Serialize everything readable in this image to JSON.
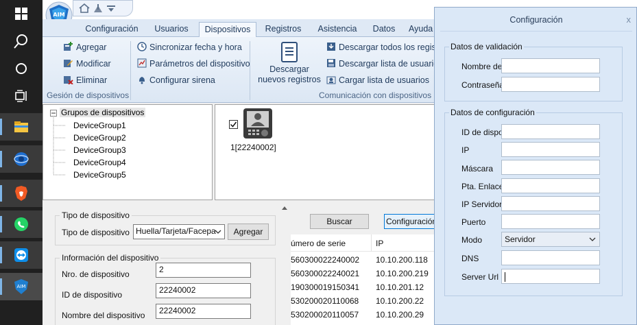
{
  "app": {
    "tabs": [
      "Configuración",
      "Usuarios",
      "Dispositivos",
      "Registros",
      "Asistencia",
      "Datos",
      "Ayuda"
    ],
    "active_tab": "Dispositivos"
  },
  "ribbon": {
    "group1": {
      "items": [
        "Agregar",
        "Modificar",
        "Eliminar"
      ],
      "label": "Gesión de dispositivos"
    },
    "group2": {
      "items": [
        "Sincronizar fecha y hora",
        "Parámetros del dispositivo",
        "Configurar sirena"
      ]
    },
    "group3": {
      "big_button_line1": "Descargar",
      "big_button_line2": "nuevos registros",
      "items": [
        "Descargar todos los registr",
        "Descargar lista de usuarios",
        "Cargar lista de usuarios"
      ],
      "label": "Comunicación con dispositivos"
    }
  },
  "tree": {
    "root": "Grupos de dispositivos",
    "children": [
      "DeviceGroup1",
      "DeviceGroup2",
      "DeviceGroup3",
      "DeviceGroup4",
      "DeviceGroup5"
    ]
  },
  "device_panel": {
    "device_label": "1[22240002]",
    "checked": true
  },
  "device_type": {
    "group_title": "Tipo de dispositivo",
    "label": "Tipo de dispositivo",
    "selected": "Huella/Tarjeta/Facepa",
    "add_button": "Agregar"
  },
  "device_info": {
    "group_title": "Información del dispositivo",
    "fields": [
      {
        "label": "Nro. de dispositivo",
        "value": "2"
      },
      {
        "label": "ID de dispositivo",
        "value": "22240002"
      },
      {
        "label": "Nombre del dispositivo",
        "value": "22240002"
      }
    ]
  },
  "search_area": {
    "search_button": "Buscar",
    "config_button": "Configuración",
    "columns": [
      "úmero de serie",
      "IP"
    ],
    "rows": [
      {
        "serial": "560300022240002",
        "ip": "10.10.200.118"
      },
      {
        "serial": "560300022240021",
        "ip": "10.10.200.219"
      },
      {
        "serial": "190300019150341",
        "ip": "10.10.201.12"
      },
      {
        "serial": "530200020110068",
        "ip": "10.10.200.22"
      },
      {
        "serial": "530200020110057",
        "ip": "10.10.200.29"
      }
    ]
  },
  "dialog": {
    "title": "Configuración",
    "close": "x",
    "validation": {
      "title": "Datos de validación",
      "fields": [
        {
          "label": "Nombre de",
          "value": ""
        },
        {
          "label": "Contraseña",
          "value": ""
        }
      ]
    },
    "config": {
      "title": "Datos de configuración",
      "fields": [
        {
          "label": "ID de dispo",
          "value": ""
        },
        {
          "label": "IP",
          "value": ""
        },
        {
          "label": "Máscara",
          "value": ""
        },
        {
          "label": "Pta. Enlace",
          "value": ""
        },
        {
          "label": "IP Servidor",
          "value": ""
        },
        {
          "label": "Puerto",
          "value": ""
        }
      ],
      "mode_label": "Modo",
      "mode_value": "Servidor",
      "dns_label": "DNS",
      "dns_value": "",
      "server_url_label": "Server Url",
      "server_url_value": ""
    }
  },
  "colors": {
    "taskbar": "#202020",
    "ribbon_tab_bg": "#dfe9f5",
    "dialog_bg": "#dbe8f7",
    "accent_text": "#1e395b"
  }
}
